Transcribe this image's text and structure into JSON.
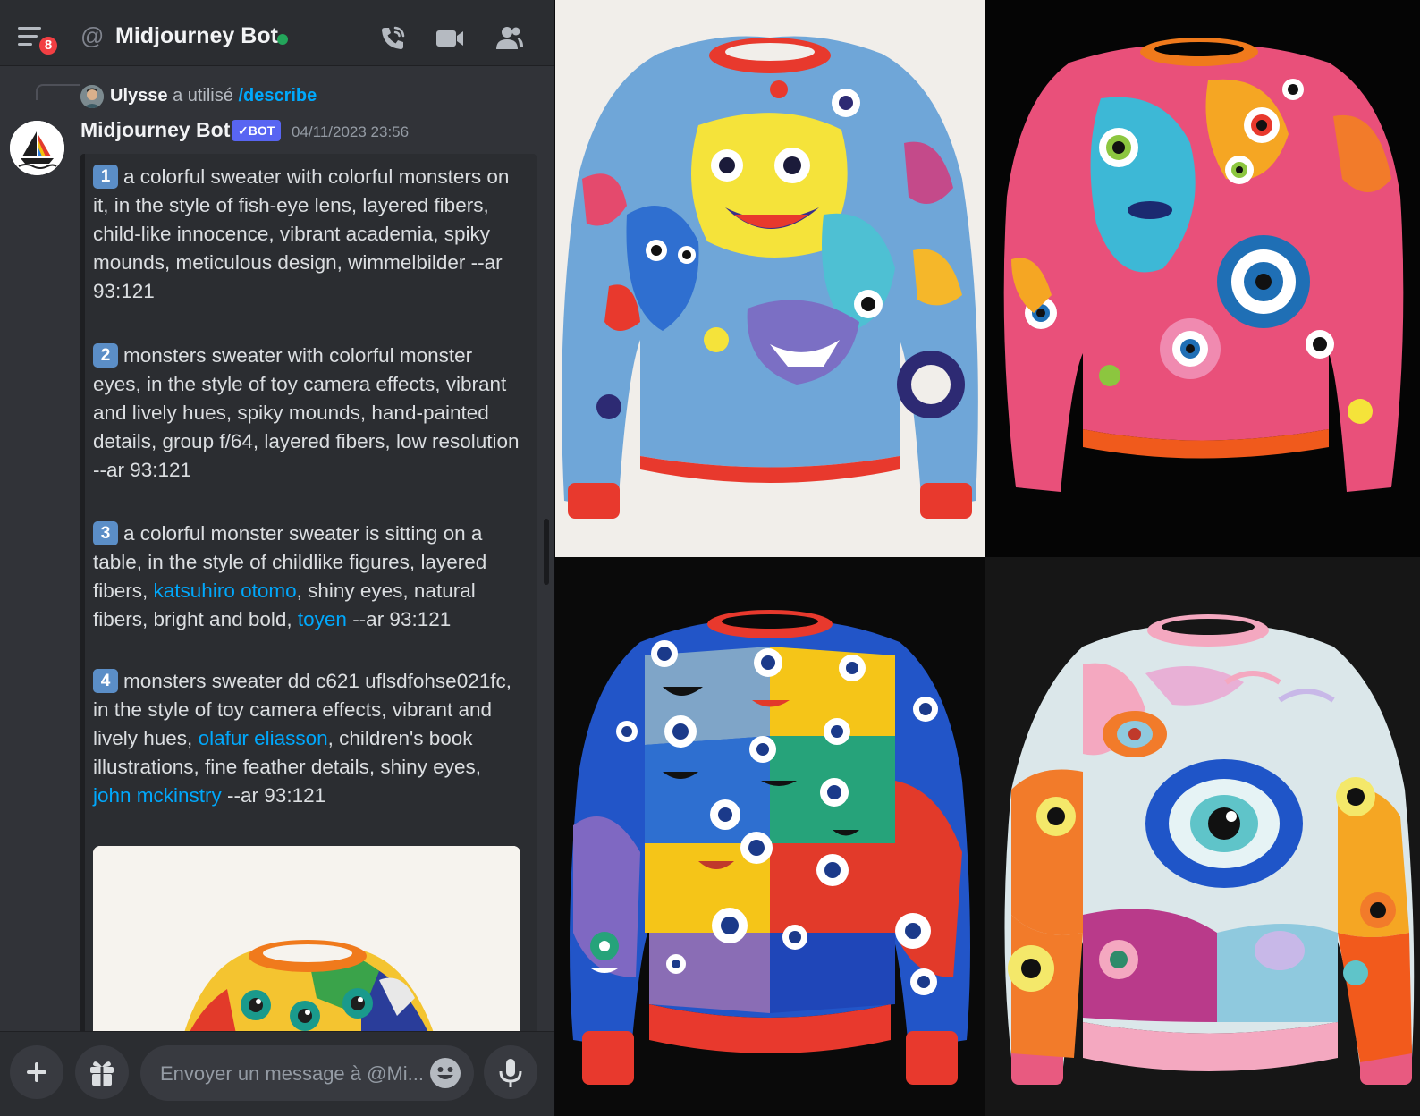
{
  "header": {
    "menu_icon": "hamburger-icon",
    "unread_count": "8",
    "at_symbol": "@",
    "title": "Midjourney Bot",
    "status_color": "#23a55a",
    "call_icon": "phone-icon",
    "video_icon": "video-camera-icon",
    "members_icon": "members-icon"
  },
  "reply": {
    "user": "Ulysse",
    "action": "a utilisé",
    "command": "/describe"
  },
  "message": {
    "author": "Midjourney Bot",
    "badge": "✓BOT",
    "timestamp": "04/11/2023 23:56",
    "prompts": [
      {
        "num": "1",
        "segments": [
          {
            "text": "a colorful sweater with colorful monsters on it, in the style of fish-eye lens, layered fibers, child-like innocence, vibrant academia, spiky mounds, meticulous design, wimmelbilder --ar 93:121",
            "link": false
          }
        ]
      },
      {
        "num": "2",
        "segments": [
          {
            "text": "monsters sweater with colorful monster eyes, in the style of toy camera effects, vibrant and lively hues, spiky mounds, hand-painted details, group f/64, layered fibers, low resolution --ar 93:121",
            "link": false
          }
        ]
      },
      {
        "num": "3",
        "segments": [
          {
            "text": "a colorful monster sweater is sitting on a table, in the style of childlike figures, layered fibers, ",
            "link": false
          },
          {
            "text": "katsuhiro otomo",
            "link": true
          },
          {
            "text": ", shiny eyes, natural fibers, bright and bold, ",
            "link": false
          },
          {
            "text": "toyen",
            "link": true
          },
          {
            "text": " --ar 93:121",
            "link": false
          }
        ]
      },
      {
        "num": "4",
        "segments": [
          {
            "text": "monsters sweater dd c621 uflsdfohse021fc, in the style of toy camera effects, vibrant and lively hues, ",
            "link": false
          },
          {
            "text": "olafur eliasson",
            "link": true
          },
          {
            "text": ", children's book illustrations, fine feather details, shiny eyes, ",
            "link": false
          },
          {
            "text": "john mckinstry",
            "link": true
          },
          {
            "text": " --ar 93:121",
            "link": false
          }
        ]
      }
    ],
    "attachment": "sweater-thumbnail-image"
  },
  "composer": {
    "add_icon": "plus-icon",
    "gift_icon": "gift-icon",
    "placeholder": "Envoyer un message à @Mi...",
    "emoji_icon": "emoji-icon",
    "mic_icon": "microphone-icon"
  },
  "gallery": {
    "images": [
      {
        "name": "sweater-image-1",
        "background": "#f1eeea"
      },
      {
        "name": "sweater-image-2",
        "background": "#050505"
      },
      {
        "name": "sweater-image-3",
        "background": "#0a0a0a"
      },
      {
        "name": "sweater-image-4",
        "background": "#161616"
      }
    ]
  },
  "colors": {
    "accent": "#5865f2",
    "link": "#00a8fc",
    "badge_red": "#f23f43"
  }
}
